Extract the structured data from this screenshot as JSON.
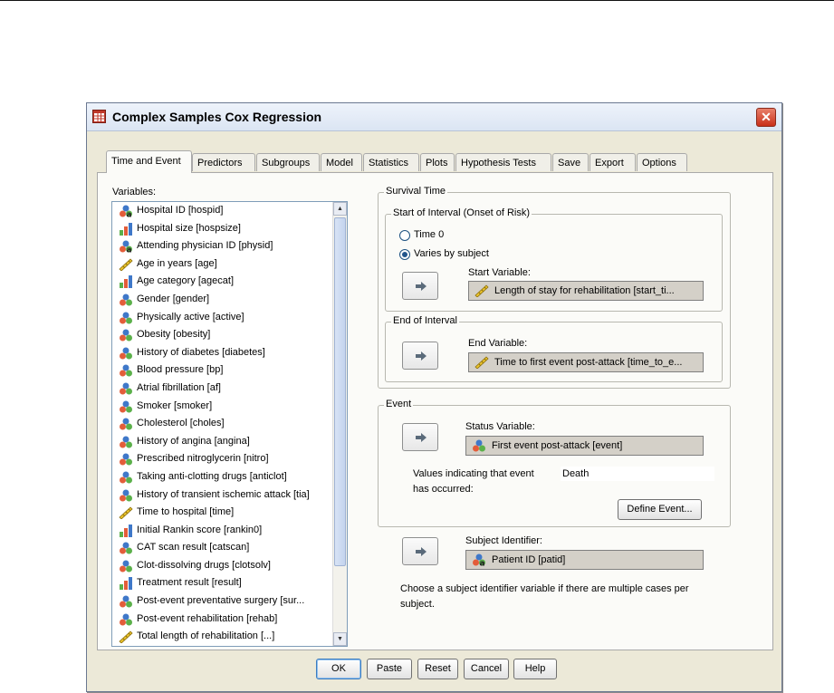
{
  "window": {
    "title": "Complex Samples Cox Regression",
    "close_label": "✕"
  },
  "tabs": [
    {
      "label": "Time and Event"
    },
    {
      "label": "Predictors"
    },
    {
      "label": "Subgroups"
    },
    {
      "label": "Model"
    },
    {
      "label": "Statistics"
    },
    {
      "label": "Plots"
    },
    {
      "label": "Hypothesis Tests"
    },
    {
      "label": "Save"
    },
    {
      "label": "Export"
    },
    {
      "label": "Options"
    }
  ],
  "variables": {
    "label": "Variables:",
    "items": [
      {
        "label": "Hospital ID [hospid]",
        "icon": "nominal-string-icon"
      },
      {
        "label": "Hospital size [hospsize]",
        "icon": "ordinal-icon"
      },
      {
        "label": "Attending physician ID [physid]",
        "icon": "nominal-string-icon"
      },
      {
        "label": "Age in years [age]",
        "icon": "scale-icon"
      },
      {
        "label": "Age category [agecat]",
        "icon": "ordinal-icon"
      },
      {
        "label": "Gender [gender]",
        "icon": "nominal-icon"
      },
      {
        "label": "Physically active [active]",
        "icon": "nominal-icon"
      },
      {
        "label": "Obesity [obesity]",
        "icon": "nominal-icon"
      },
      {
        "label": "History of diabetes [diabetes]",
        "icon": "nominal-icon"
      },
      {
        "label": "Blood pressure [bp]",
        "icon": "nominal-icon"
      },
      {
        "label": "Atrial fibrillation [af]",
        "icon": "nominal-icon"
      },
      {
        "label": "Smoker [smoker]",
        "icon": "nominal-icon"
      },
      {
        "label": "Cholesterol [choles]",
        "icon": "nominal-icon"
      },
      {
        "label": "History of angina [angina]",
        "icon": "nominal-icon"
      },
      {
        "label": "Prescribed nitroglycerin [nitro]",
        "icon": "nominal-icon"
      },
      {
        "label": "Taking anti-clotting drugs [anticlot]",
        "icon": "nominal-icon"
      },
      {
        "label": "History of transient ischemic attack [tia]",
        "icon": "nominal-icon"
      },
      {
        "label": "Time to hospital [time]",
        "icon": "scale-icon"
      },
      {
        "label": "Initial Rankin score [rankin0]",
        "icon": "ordinal-icon"
      },
      {
        "label": "CAT scan result [catscan]",
        "icon": "nominal-icon"
      },
      {
        "label": "Clot-dissolving drugs [clotsolv]",
        "icon": "nominal-icon"
      },
      {
        "label": "Treatment result [result]",
        "icon": "ordinal-icon"
      },
      {
        "label": "Post-event preventative surgery [sur...",
        "icon": "nominal-icon"
      },
      {
        "label": "Post-event rehabilitation [rehab]",
        "icon": "nominal-icon"
      },
      {
        "label": "Total length of rehabilitation [...]",
        "icon": "scale-icon"
      }
    ]
  },
  "survival_time": {
    "label": "Survival Time",
    "start_interval": {
      "label": "Start of Interval (Onset of Risk)",
      "options": [
        "Time 0",
        "Varies by subject"
      ],
      "selected": "Varies by subject",
      "start_variable_label": "Start Variable:",
      "start_variable_value": "Length of stay for rehabilitation [start_ti..."
    },
    "end_interval": {
      "label": "End of Interval",
      "end_variable_label": "End Variable:",
      "end_variable_value": "Time to first event post-attack [time_to_e..."
    }
  },
  "event": {
    "label": "Event",
    "status_variable_label": "Status Variable:",
    "status_variable_value": "First event post-attack [event]",
    "values_label_line1": "Values indicating that event",
    "values_label_line2": "has occurred:",
    "values_value": "Death",
    "define_button": "Define Event..."
  },
  "subject": {
    "label": "Subject Identifier:",
    "value": "Patient ID [patid]",
    "note_line1": "Choose a subject identifier variable if there are multiple cases per",
    "note_line2": "subject."
  },
  "buttons": {
    "ok": "OK",
    "paste": "Paste",
    "reset": "Reset",
    "cancel": "Cancel",
    "help": "Help"
  }
}
